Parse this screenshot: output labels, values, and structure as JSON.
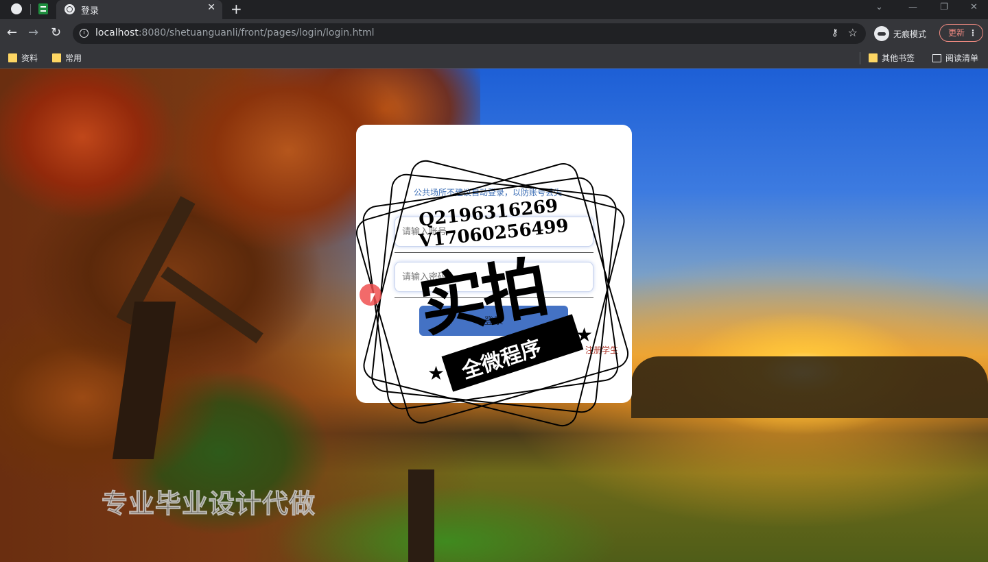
{
  "browser": {
    "tab_title": "登录",
    "url_host": "localhost",
    "url_rest": ":8080/shetuanguanli/front/pages/login/login.html",
    "incognito_label": "无痕模式",
    "update_label": "更新",
    "bookmarks": [
      "资料",
      "常用"
    ],
    "other_bookmarks": "其他书签",
    "reading_list": "阅读清单"
  },
  "login": {
    "tip": "公共场所不建议自动登录，以防账号丢失",
    "username_placeholder": "请输入账号",
    "password_placeholder": "请输入密码",
    "login_button": "登录",
    "register_link": "注册学生"
  },
  "overlay": {
    "qq": "Q2196316269",
    "wechat": "V17060256499",
    "stamp_main": "实拍",
    "stamp_ribbon": "全微程序",
    "bottom_watermark": "专业毕业设计代做"
  },
  "colors": {
    "login_button": "#4472c4",
    "register_link": "#b03a2e",
    "tip_text": "#3d6fb6"
  }
}
